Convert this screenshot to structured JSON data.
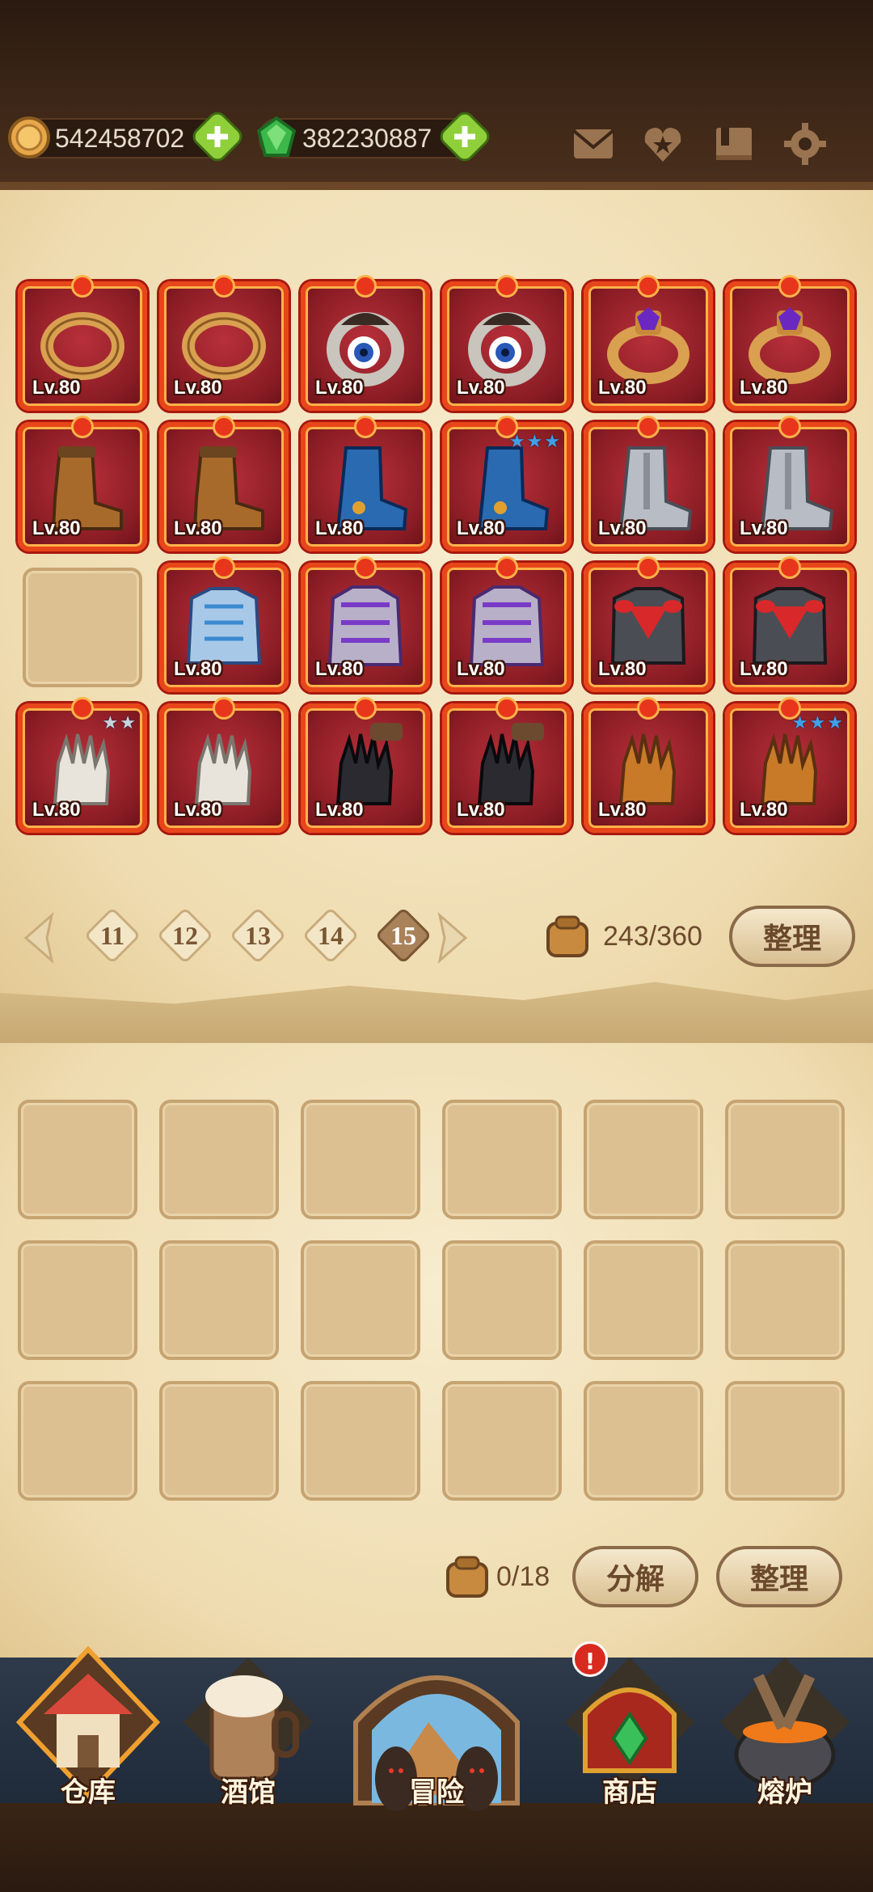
{
  "resources": {
    "gold": "542458702",
    "gems": "382230887"
  },
  "items": [
    {
      "level": "Lv.80",
      "kind": "ring-bronze"
    },
    {
      "level": "Lv.80",
      "kind": "ring-bronze"
    },
    {
      "level": "Lv.80",
      "kind": "ring-eye"
    },
    {
      "level": "Lv.80",
      "kind": "ring-eye"
    },
    {
      "level": "Lv.80",
      "kind": "ring-amethyst"
    },
    {
      "level": "Lv.80",
      "kind": "ring-amethyst"
    },
    {
      "level": "Lv.80",
      "kind": "boots-leather"
    },
    {
      "level": "Lv.80",
      "kind": "boots-leather"
    },
    {
      "level": "Lv.80",
      "kind": "boots-blue"
    },
    {
      "level": "Lv.80",
      "kind": "boots-blue",
      "stars": 3
    },
    {
      "level": "Lv.80",
      "kind": "boots-steel"
    },
    {
      "level": "Lv.80",
      "kind": "boots-steel"
    },
    {
      "empty": true
    },
    {
      "level": "Lv.80",
      "kind": "armor-ice"
    },
    {
      "level": "Lv.80",
      "kind": "armor-violet"
    },
    {
      "level": "Lv.80",
      "kind": "armor-violet"
    },
    {
      "level": "Lv.80",
      "kind": "armor-dark"
    },
    {
      "level": "Lv.80",
      "kind": "armor-dark"
    },
    {
      "level": "Lv.80",
      "kind": "gloves-white",
      "stars": 2,
      "stars_dim": true
    },
    {
      "level": "Lv.80",
      "kind": "gloves-white"
    },
    {
      "level": "Lv.80",
      "kind": "gloves-black"
    },
    {
      "level": "Lv.80",
      "kind": "gloves-black"
    },
    {
      "level": "Lv.80",
      "kind": "gloves-brown"
    },
    {
      "level": "Lv.80",
      "kind": "gloves-brown",
      "stars": 3
    }
  ],
  "pager": {
    "pages": [
      "11",
      "12",
      "13",
      "14",
      "15"
    ],
    "active": "15"
  },
  "inventory": {
    "capacity": "243/360",
    "sort_label": "整理"
  },
  "salvage": {
    "count": "0/18",
    "decompose_label": "分解",
    "sort_label": "整理",
    "slots": 18
  },
  "nav": [
    {
      "label": "仓库",
      "icon": "warehouse-icon",
      "active": true
    },
    {
      "label": "酒馆",
      "icon": "tavern-icon"
    },
    {
      "label": "冒险",
      "icon": "adventure-icon"
    },
    {
      "label": "商店",
      "icon": "shop-icon",
      "badge": "!"
    },
    {
      "label": "熔炉",
      "icon": "furnace-icon"
    }
  ],
  "colors": {
    "item_border": "#e8461a",
    "item_bg": "#8a1c24",
    "parchment": "#efdcb0",
    "star": "#3fa0e8"
  }
}
